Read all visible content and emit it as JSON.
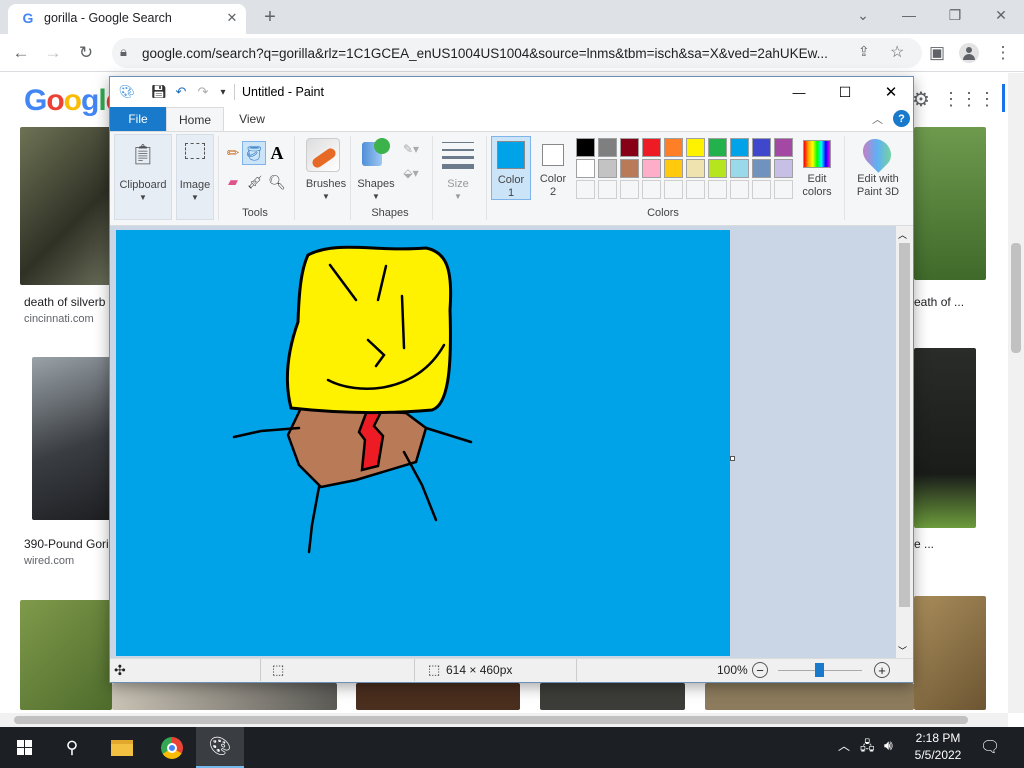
{
  "browser": {
    "tab_title": "gorilla - Google Search",
    "tab_favicon": "G",
    "new_tab": "+",
    "url": "google.com/search?q=gorilla&rlz=1C1GCEA_enUS1004US1004&source=lnms&tbm=isch&sa=X&ved=2ahUKEw..."
  },
  "google": {
    "logo": "Google",
    "results": [
      {
        "title": "death of silverb",
        "source": "cincinnati.com"
      },
      {
        "title": "390-Pound Gori",
        "source": "wired.com"
      },
      {
        "title": "eath of ...",
        "source": ""
      },
      {
        "title": "e ...",
        "source": ""
      }
    ]
  },
  "paint": {
    "title": "Untitled - Paint",
    "menu": {
      "file": "File",
      "home": "Home",
      "view": "View"
    },
    "ribbon": {
      "clipboard": "Clipboard",
      "image": "Image",
      "tools": "Tools",
      "brushes": "Brushes",
      "shapes_btn": "Shapes",
      "shapes_group": "Shapes",
      "size": "Size",
      "color1_a": "Color",
      "color1_b": "1",
      "color2_a": "Color",
      "color2_b": "2",
      "colors": "Colors",
      "edit_colors_a": "Edit",
      "edit_colors_b": "colors",
      "paint3d_a": "Edit with",
      "paint3d_b": "Paint 3D"
    },
    "palette_row1": [
      "#000000",
      "#7f7f7f",
      "#880015",
      "#ed1c24",
      "#ff7f27",
      "#fff200",
      "#22b14c",
      "#00a2e8",
      "#3f48cc",
      "#a349a4"
    ],
    "palette_row2": [
      "#ffffff",
      "#c3c3c3",
      "#b97a57",
      "#ffaec9",
      "#ffc90e",
      "#efe4b0",
      "#b5e61d",
      "#99d9ea",
      "#7092be",
      "#c8bfe7"
    ],
    "color1": "#00a2e8",
    "color2": "#ffffff",
    "status": {
      "dimensions": "614 × 460px",
      "zoom": "100%"
    }
  },
  "taskbar": {
    "time": "2:18 PM",
    "date": "5/5/2022"
  }
}
